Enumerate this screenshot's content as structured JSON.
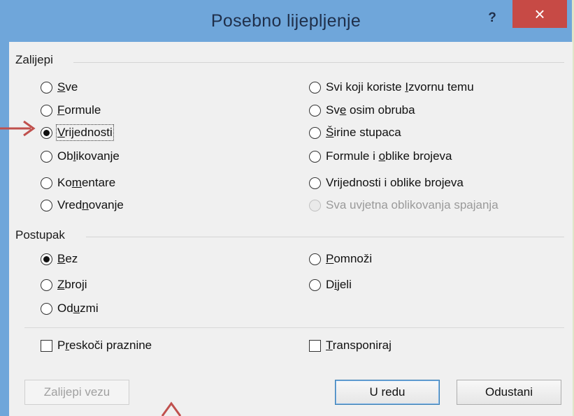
{
  "dialog": {
    "title": "Posebno lijepljenje",
    "help_label": "?",
    "close_label": "×"
  },
  "paste_group": {
    "label": "Zalijepi",
    "left_options": [
      {
        "pre": "",
        "ul": "S",
        "post": "ve",
        "checked": false
      },
      {
        "pre": "",
        "ul": "F",
        "post": "ormule",
        "checked": false
      },
      {
        "pre": "",
        "ul": "V",
        "post": "rijednosti",
        "checked": true
      },
      {
        "pre": "Ob",
        "ul": "l",
        "post": "ikovanje",
        "checked": false
      },
      {
        "pre": "Ko",
        "ul": "m",
        "post": "entare",
        "checked": false
      },
      {
        "pre": "Vred",
        "ul": "n",
        "post": "ovanje",
        "checked": false
      }
    ],
    "right_options": [
      {
        "pre": "Svi koji koriste ",
        "ul": "I",
        "post": "zvornu temu",
        "checked": false,
        "disabled": false
      },
      {
        "pre": "Sv",
        "ul": "e",
        "post": " osim obruba",
        "checked": false,
        "disabled": false
      },
      {
        "pre": "",
        "ul": "Š",
        "post": "irine stupaca",
        "checked": false,
        "disabled": false
      },
      {
        "pre": "Formule i ",
        "ul": "o",
        "post": "blike brojeva",
        "checked": false,
        "disabled": false
      },
      {
        "pre": "Vri",
        "ul": "j",
        "post": "ednosti i oblike brojeva",
        "checked": false,
        "disabled": false
      },
      {
        "pre": "Sva uvjetna oblikovanja spajanja",
        "ul": "",
        "post": "",
        "checked": false,
        "disabled": true
      }
    ]
  },
  "operation_group": {
    "label": "Postupak",
    "left_options": [
      {
        "pre": "",
        "ul": "B",
        "post": "ez",
        "checked": true
      },
      {
        "pre": "",
        "ul": "Z",
        "post": "broji",
        "checked": false
      },
      {
        "pre": "Od",
        "ul": "u",
        "post": "zmi",
        "checked": false
      }
    ],
    "right_options": [
      {
        "pre": "",
        "ul": "P",
        "post": "omnoži",
        "checked": false
      },
      {
        "pre": "D",
        "ul": "i",
        "post": "jeli",
        "checked": false
      }
    ]
  },
  "checkboxes": {
    "skip_blanks": {
      "pre": "P",
      "ul": "r",
      "post": "eskoči praznine",
      "checked": false
    },
    "transpose": {
      "pre": "",
      "ul": "T",
      "post": "ransponiraj",
      "checked": false
    }
  },
  "buttons": {
    "paste_link": "Zalijepi vezu",
    "ok": "U redu",
    "cancel": "Odustani"
  },
  "colors": {
    "title_bar": "#6fa6da",
    "close_button": "#c74a45",
    "annotation_arrow": "#c0504d",
    "background": "#dfe6c8"
  }
}
